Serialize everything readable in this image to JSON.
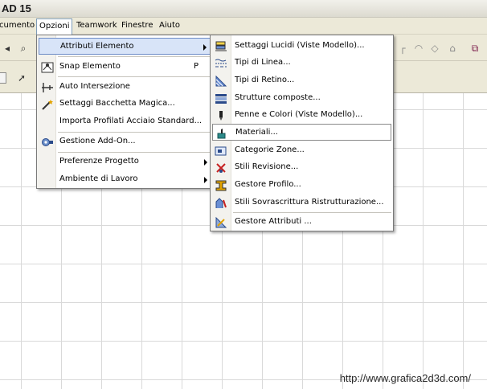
{
  "window": {
    "title": "AD 15"
  },
  "menubar": {
    "items": [
      {
        "label": "cumento"
      },
      {
        "label": "Opzioni"
      },
      {
        "label": "Teamwork"
      },
      {
        "label": "Finestre"
      },
      {
        "label": "Aiuto"
      }
    ]
  },
  "options_menu": {
    "items": [
      {
        "label": "Attributi Elemento",
        "icon": "none",
        "has_submenu": true
      },
      {
        "label": "Snap Elemento",
        "shortcut": "P",
        "icon": "snap-icon"
      },
      {
        "label": "Auto Intersezione",
        "icon": "intersection-icon"
      },
      {
        "label": "Settaggi Bacchetta Magica...",
        "icon": "magic-wand-icon"
      },
      {
        "label": "Importa Profilati Acciaio Standard...",
        "icon": "none"
      },
      {
        "label": "Gestione Add-On...",
        "icon": "add-on-icon"
      },
      {
        "label": "Preferenze Progetto",
        "has_submenu": true
      },
      {
        "label": "Ambiente di Lavoro",
        "has_submenu": true
      }
    ]
  },
  "attributes_submenu": {
    "items": [
      {
        "label": "Settaggi Lucidi (Viste Modello)...",
        "icon": "layers-icon"
      },
      {
        "label": "Tipi di Linea...",
        "icon": "line-types-icon"
      },
      {
        "label": "Tipi di Retino...",
        "icon": "fill-types-icon"
      },
      {
        "label": "Strutture composte...",
        "icon": "composite-icon"
      },
      {
        "label": "Penne e Colori (Viste Modello)...",
        "icon": "pen-icon"
      },
      {
        "label": "Materiali...",
        "icon": "materials-icon"
      },
      {
        "label": "Categorie Zone...",
        "icon": "zone-categories-icon"
      },
      {
        "label": "Stili Revisione...",
        "icon": "revision-styles-icon"
      },
      {
        "label": "Gestore Profilo...",
        "icon": "profile-manager-icon"
      },
      {
        "label": "Stili Sovrascrittura Ristrutturazione...",
        "icon": "renovation-icon"
      },
      {
        "label": "Gestore Attributi ...",
        "icon": "attribute-manager-icon"
      }
    ]
  },
  "watermark": {
    "text": "http://www.grafica2d3d.com/"
  },
  "colors": {
    "highlight": "#d8e4f8",
    "highlight_border": "#6d8cc6",
    "menubar": "#ece9d8"
  }
}
